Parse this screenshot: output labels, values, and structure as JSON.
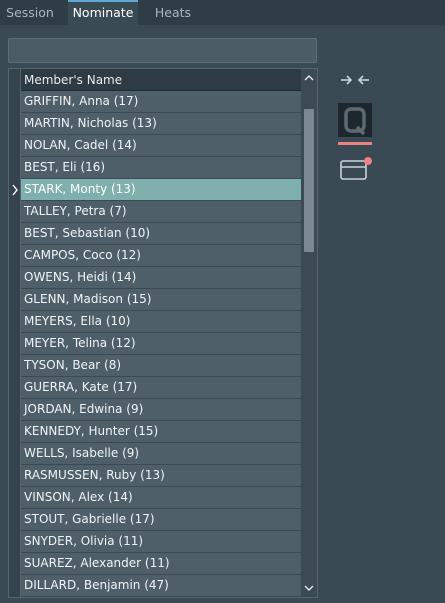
{
  "tabs": [
    {
      "label": "Session",
      "active": false
    },
    {
      "label": "Nominate",
      "active": true
    },
    {
      "label": "Heats",
      "active": false
    }
  ],
  "filter": {
    "value": "",
    "placeholder": ""
  },
  "grid": {
    "column_header": "Member's Name",
    "selected_index": 4,
    "rows": [
      "GRIFFIN, Anna (17)",
      "MARTIN, Nicholas (13)",
      "NOLAN, Cadel (14)",
      "BEST, Eli (16)",
      "STARK, Monty (13)",
      "TALLEY, Petra (7)",
      "BEST, Sebastian (10)",
      "CAMPOS, Coco (12)",
      "OWENS, Heidi (14)",
      "GLENN, Madison (15)",
      "MEYERS, Ella (10)",
      "MEYER, Telina (12)",
      "TYSON, Bear (8)",
      "GUERRA, Kate (17)",
      "JORDAN, Edwina (9)",
      "KENNEDY, Hunter (15)",
      "WELLS, Isabelle (9)",
      "RASMUSSEN, Ruby (13)",
      "VINSON, Alex (14)",
      "STOUT, Gabrielle (17)",
      "SNYDER, Olivia (11)",
      "SUAREZ, Alexander (11)",
      "DILLARD, Benjamin (47)"
    ]
  },
  "scrollbar": {
    "up_glyph": "⌃",
    "down_glyph": "⌄"
  },
  "toolbar": {
    "icons": [
      "collapse-arrows-icon",
      "quick-q-icon",
      "card-notification-icon"
    ],
    "accent_color": "#f08080"
  },
  "colors": {
    "background": "#3a4a55",
    "row": "#4f5f6a",
    "selected_row": "#7fb0ae",
    "header": "#2e3b44"
  }
}
